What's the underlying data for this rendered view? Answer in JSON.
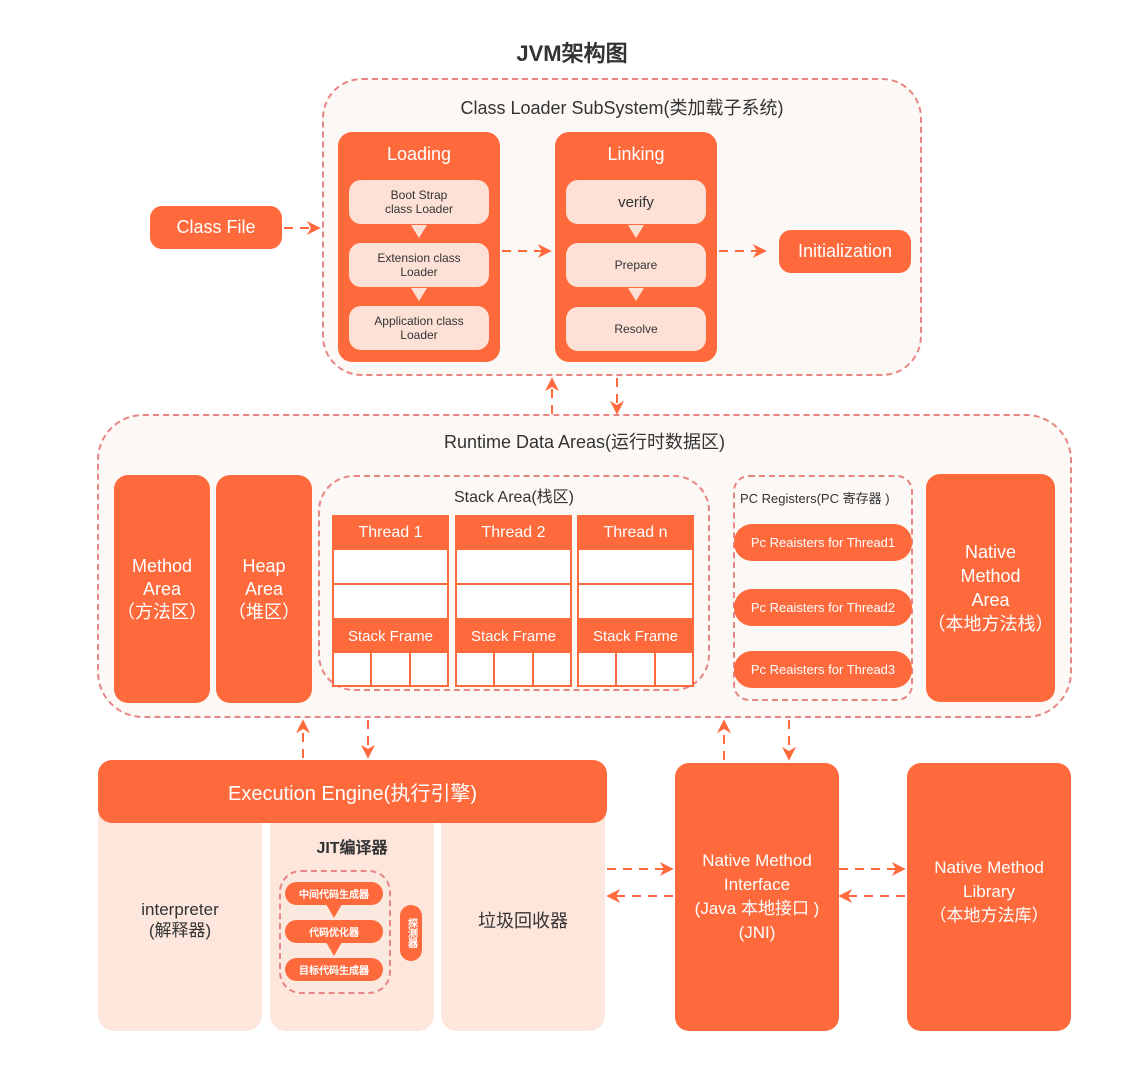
{
  "title": "JVM架构图",
  "class_loader": {
    "title": "Class Loader SubSystem(类加载子系统)",
    "class_file": "Class File",
    "loading": {
      "title": "Loading",
      "items": [
        "Boot Strap\nclass Loader",
        "Extension class\nLoader",
        "Application class\nLoader"
      ]
    },
    "linking": {
      "title": "Linking",
      "items": [
        "verify",
        "Prepare",
        "Resolve"
      ]
    },
    "initialization": "Initialization"
  },
  "runtime": {
    "title": "Runtime Data Areas(运行时数据区)",
    "method_area": [
      "Method",
      "Area",
      "（方法区）"
    ],
    "heap_area": [
      "Heap",
      "Area",
      "（堆区）"
    ],
    "stack_area": {
      "title": "Stack Area(栈区)",
      "threads": [
        "Thread 1",
        "Thread 2",
        "Thread n"
      ],
      "frame_label": "Stack Frame"
    },
    "pc_registers": {
      "title": "PC Registers(PC 寄存器 )",
      "items": [
        "Pc Reaisters for Thread1",
        "Pc Reaisters for Thread2",
        "Pc Reaisters for Thread3"
      ]
    },
    "native_method_area": [
      "Native",
      "Method",
      "Area",
      "（本地方法栈）"
    ]
  },
  "execution": {
    "title": "Execution Engine(执行引擎)",
    "interpreter": [
      "interpreter",
      "(解释器)"
    ],
    "jit": {
      "title": "JIT编译器",
      "steps": [
        "中间代码生成器",
        "代码优化器",
        "目标代码生成器"
      ],
      "profiler": "探测器"
    },
    "gc": "垃圾回收器"
  },
  "native_interface": [
    "Native Method",
    "Interface",
    "(Java 本地接口 )",
    "(JNI)"
  ],
  "native_library": [
    "Native Method",
    "Library",
    "（本地方法库）"
  ],
  "colors": {
    "accent": "#ff6a3d",
    "pale": "#fde1d6",
    "dashed_border": "#e88585",
    "group_bg": "#fcf8f5"
  }
}
